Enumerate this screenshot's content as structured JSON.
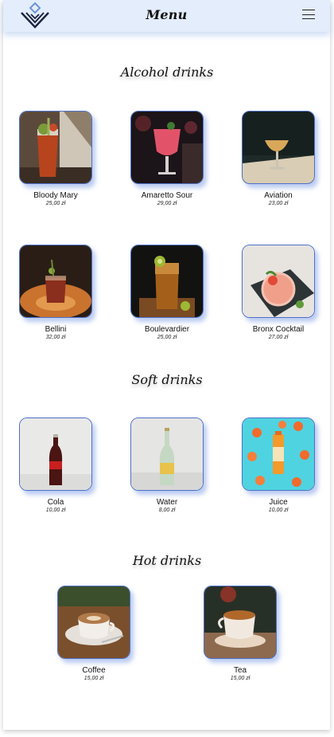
{
  "header": {
    "title": "Menu",
    "logo_icon": "diamond-chevron-logo-icon",
    "menu_icon": "hamburger-icon"
  },
  "sections": {
    "alcohol": {
      "title": "Alcohol drinks",
      "items": [
        {
          "name": "Bloody Mary",
          "price": "25,00 zł"
        },
        {
          "name": "Amaretto Sour",
          "price": "29,00 zł"
        },
        {
          "name": "Aviation",
          "price": "23,00 zł"
        },
        {
          "name": "Bellini",
          "price": "32,00 zł"
        },
        {
          "name": "Boulevardier",
          "price": "25,00 zł"
        },
        {
          "name": "Bronx Cocktail",
          "price": "27,00 zł"
        }
      ]
    },
    "soft": {
      "title": "Soft drinks",
      "items": [
        {
          "name": "Cola",
          "price": "10,00 zł"
        },
        {
          "name": "Water",
          "price": "8,00 zł"
        },
        {
          "name": "Juice",
          "price": "10,00 zł"
        }
      ]
    },
    "hot": {
      "title": "Hot drinks",
      "items": [
        {
          "name": "Coffee",
          "price": "15,00 zł"
        },
        {
          "name": "Tea",
          "price": "15,00 zł"
        }
      ]
    }
  },
  "colors": {
    "header_bg": "#e3edfb",
    "thumb_border": "#4e70c8",
    "thumb_shadow": "#82a0e6"
  }
}
